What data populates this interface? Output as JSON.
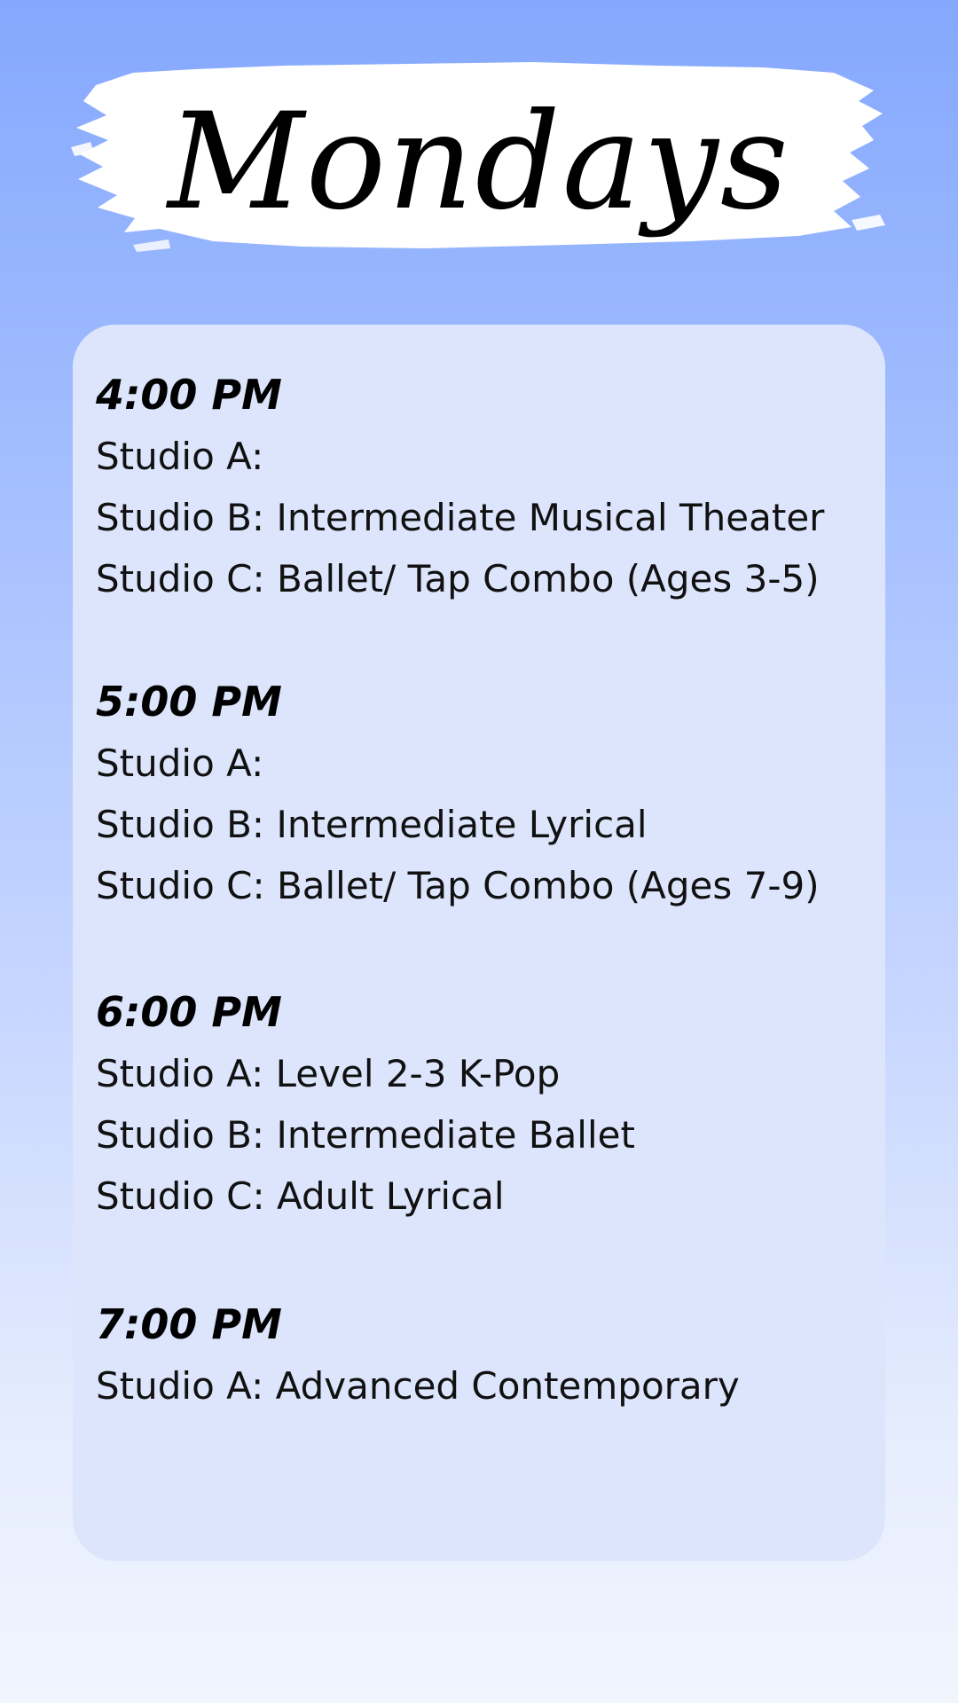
{
  "header": {
    "title": "Mondays"
  },
  "schedule": [
    {
      "time": "4:00 PM",
      "rows": [
        "Studio A:",
        "Studio B: Intermediate Musical Theater",
        "Studio C: Ballet/ Tap Combo (Ages 3-5)"
      ]
    },
    {
      "time": "5:00 PM",
      "rows": [
        "Studio A:",
        "Studio B: Intermediate Lyrical",
        "Studio C: Ballet/ Tap Combo (Ages 7-9)"
      ]
    },
    {
      "time": "6:00 PM",
      "rows": [
        "Studio A: Level 2-3 K-Pop",
        "Studio B: Intermediate Ballet",
        "Studio C: Adult Lyrical"
      ]
    },
    {
      "time": "7:00 PM",
      "rows": [
        "Studio A: Advanced Contemporary"
      ]
    }
  ],
  "colors": {
    "gradient_top": "#85a8fd",
    "gradient_bottom": "#f1f5fe",
    "card": "#dce5fc",
    "banner": "#ffffff",
    "text": "#000000"
  }
}
